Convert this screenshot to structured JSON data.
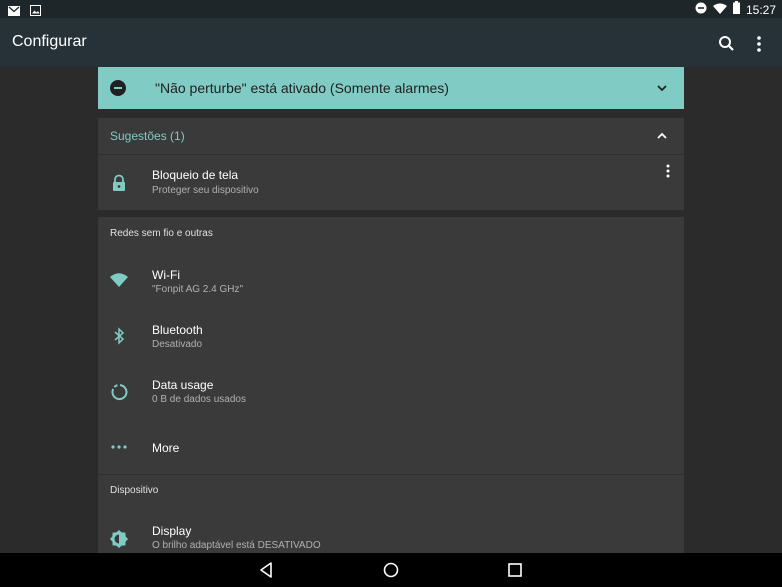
{
  "status_bar": {
    "time": "15:27",
    "left_icons": [
      "gmail-icon",
      "image-icon"
    ],
    "right_icons": [
      "do-not-disturb-icon",
      "wifi-icon",
      "battery-icon"
    ]
  },
  "app_bar": {
    "title": "Configurar",
    "actions": [
      "search-icon",
      "more-vert-icon"
    ]
  },
  "dnd_banner": {
    "text": "\"Não perturbe\" está ativado (Somente alarmes)",
    "color": "#80cbc4"
  },
  "suggestions": {
    "title": "Sugestões (1)",
    "items": [
      {
        "title": "Bloqueio de tela",
        "subtitle": "Proteger seu dispositivo",
        "icon": "lock-icon"
      }
    ]
  },
  "sections": [
    {
      "header": "Redes sem fio e outras",
      "items": [
        {
          "title": "Wi-Fi",
          "subtitle": "\"Fonpit AG 2.4 GHz\"",
          "icon": "wifi-icon"
        },
        {
          "title": "Bluetooth",
          "subtitle": "Desativado",
          "icon": "bluetooth-icon"
        },
        {
          "title": "Data usage",
          "subtitle": "0 B de dados usados",
          "icon": "data-usage-icon"
        },
        {
          "title": "More",
          "subtitle": "",
          "icon": "more-horiz-icon"
        }
      ]
    },
    {
      "header": "Dispositivo",
      "items": [
        {
          "title": "Display",
          "subtitle": "O brilho adaptável está DESATIVADO",
          "icon": "brightness-icon"
        }
      ]
    }
  ],
  "nav_bar": [
    "back-icon",
    "home-icon",
    "recents-icon"
  ],
  "colors": {
    "accent": "#80cbc4",
    "app_bar": "#263238",
    "status_bar": "#1f262a",
    "card": "#3a3a3a",
    "background": "#2b2b2b"
  }
}
